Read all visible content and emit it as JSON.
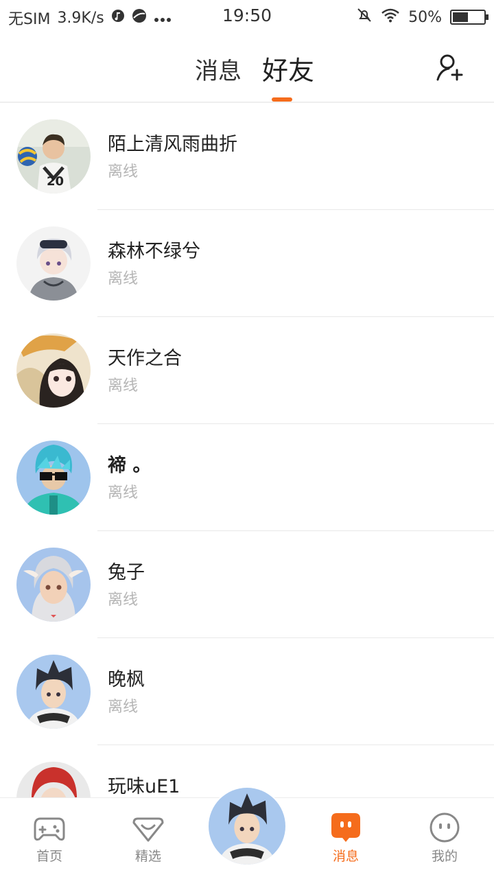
{
  "status_bar": {
    "carrier": "无SIM",
    "speed": "3.9K/s",
    "time": "19:50",
    "battery": "50%",
    "battery_level": 0.5
  },
  "header": {
    "tabs": [
      {
        "label": "消息",
        "active": false
      },
      {
        "label": "好友",
        "active": true
      }
    ],
    "add_friend_icon": "add-user-icon",
    "accent_color": "#f56c1c"
  },
  "friends": [
    {
      "name": "陌上清风雨曲折",
      "status": "离线",
      "bold": false
    },
    {
      "name": "森林不绿兮",
      "status": "离线",
      "bold": false
    },
    {
      "name": "天作之合",
      "status": "离线",
      "bold": false
    },
    {
      "name": "褅 。",
      "status": "离线",
      "bold": true
    },
    {
      "name": "兔子",
      "status": "离线",
      "bold": false
    },
    {
      "name": "晚枫",
      "status": "离线",
      "bold": false
    },
    {
      "name": "玩味uE1",
      "status": "",
      "bold": false
    }
  ],
  "bottom_nav": {
    "items": [
      {
        "label": "首页",
        "icon": "gamepad-icon",
        "active": false
      },
      {
        "label": "精选",
        "icon": "heart-box-icon",
        "active": false
      },
      {
        "label": "消息",
        "icon": "chat-bubble-icon",
        "active": true
      },
      {
        "label": "我的",
        "icon": "face-icon",
        "active": false
      }
    ]
  }
}
